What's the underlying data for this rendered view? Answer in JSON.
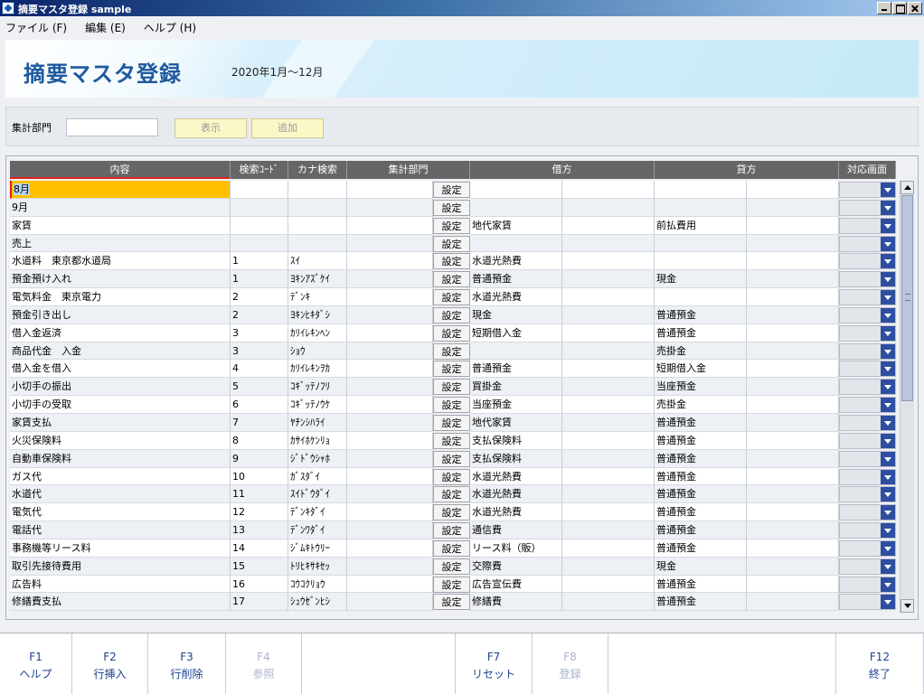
{
  "window": {
    "title": "摘要マスタ登録 sample"
  },
  "menu": [
    "ファイル (F)",
    "編集 (E)",
    "ヘルプ (H)"
  ],
  "banner": {
    "heading": "摘要マスタ登録",
    "period": "2020年1月～12月"
  },
  "filter": {
    "label": "集計部門",
    "value": "",
    "show_button": "表示",
    "add_button": "追加"
  },
  "columns": [
    "内容",
    "検索ｺｰﾄﾞ",
    "カナ検索",
    "集計部門",
    "借方",
    "貸方",
    "対応画面"
  ],
  "set_label": "設定",
  "rows": [
    {
      "naiyo": "8月",
      "code": "",
      "kana": "",
      "debit": "",
      "credit": ""
    },
    {
      "naiyo": "9月",
      "code": "",
      "kana": "",
      "debit": "",
      "credit": ""
    },
    {
      "naiyo": "家賃",
      "code": "",
      "kana": "",
      "debit": "地代家賃",
      "credit": "前払費用"
    },
    {
      "naiyo": "売上",
      "code": "",
      "kana": "",
      "debit": "",
      "credit": ""
    },
    {
      "naiyo": "水道料　東京都水道局",
      "code": "1",
      "kana": "ｽｲ",
      "debit": "水道光熱費",
      "credit": ""
    },
    {
      "naiyo": "預金預け入れ",
      "code": "1",
      "kana": "ﾖｷﾝｱｽﾞｹｲ",
      "debit": "普通預金",
      "credit": "現金"
    },
    {
      "naiyo": "電気料金　東京電力",
      "code": "2",
      "kana": "ﾃﾞﾝｷ",
      "debit": "水道光熱費",
      "credit": ""
    },
    {
      "naiyo": "預金引き出し",
      "code": "2",
      "kana": "ﾖｷﾝﾋｷﾀﾞｼ",
      "debit": "現金",
      "credit": "普通預金"
    },
    {
      "naiyo": "借入金返済",
      "code": "3",
      "kana": "ｶﾘｲﾚｷﾝﾍﾝ",
      "debit": "短期借入金",
      "credit": "普通預金"
    },
    {
      "naiyo": "商品代金　入金",
      "code": "3",
      "kana": "ｼｮｳ",
      "debit": "",
      "credit": "売掛金"
    },
    {
      "naiyo": "借入金を借入",
      "code": "4",
      "kana": "ｶﾘｲﾚｷﾝｦｶ",
      "debit": "普通預金",
      "credit": "短期借入金"
    },
    {
      "naiyo": "小切手の振出",
      "code": "5",
      "kana": "ｺｷﾞｯﾃﾉﾌﾘ",
      "debit": "買掛金",
      "credit": "当座預金"
    },
    {
      "naiyo": "小切手の受取",
      "code": "6",
      "kana": "ｺｷﾞｯﾃﾉｳｹ",
      "debit": "当座預金",
      "credit": "売掛金"
    },
    {
      "naiyo": "家賃支払",
      "code": "7",
      "kana": "ﾔﾁﾝｼﾊﾗｲ",
      "debit": "地代家賃",
      "credit": "普通預金"
    },
    {
      "naiyo": "火災保険料",
      "code": "8",
      "kana": "ｶｻｲﾎｹﾝﾘｮ",
      "debit": "支払保険料",
      "credit": "普通預金"
    },
    {
      "naiyo": "自動車保険料",
      "code": "9",
      "kana": "ｼﾞﾄﾞｳｼｬﾎ",
      "debit": "支払保険料",
      "credit": "普通預金"
    },
    {
      "naiyo": "ガス代",
      "code": "10",
      "kana": "ｶﾞｽﾀﾞｲ",
      "debit": "水道光熱費",
      "credit": "普通預金"
    },
    {
      "naiyo": "水道代",
      "code": "11",
      "kana": "ｽｲﾄﾞｳﾀﾞｲ",
      "debit": "水道光熱費",
      "credit": "普通預金"
    },
    {
      "naiyo": "電気代",
      "code": "12",
      "kana": "ﾃﾞﾝｷﾀﾞｲ",
      "debit": "水道光熱費",
      "credit": "普通預金"
    },
    {
      "naiyo": "電話代",
      "code": "13",
      "kana": "ﾃﾞﾝﾜﾀﾞｲ",
      "debit": "通信費",
      "credit": "普通預金"
    },
    {
      "naiyo": "事務機等リース料",
      "code": "14",
      "kana": "ｼﾞﾑｷﾄｳﾘｰ",
      "debit": "リース料（販）",
      "credit": "普通預金"
    },
    {
      "naiyo": "取引先接待費用",
      "code": "15",
      "kana": "ﾄﾘﾋｷｻｷｾｯ",
      "debit": "交際費",
      "credit": "現金"
    },
    {
      "naiyo": "広告料",
      "code": "16",
      "kana": "ｺｳｺｸﾘｮｳ",
      "debit": "広告宣伝費",
      "credit": "普通預金"
    },
    {
      "naiyo": "修繕費支払",
      "code": "17",
      "kana": "ｼｭｳｾﾞﾝﾋｼ",
      "debit": "修繕費",
      "credit": "普通預金"
    }
  ],
  "fkeys": [
    {
      "key": "F1",
      "label": "ヘルプ",
      "enabled": true
    },
    {
      "key": "F2",
      "label": "行挿入",
      "enabled": true
    },
    {
      "key": "F3",
      "label": "行削除",
      "enabled": true
    },
    {
      "key": "F4",
      "label": "参照",
      "enabled": false
    },
    {
      "key": "",
      "label": "",
      "enabled": false
    },
    {
      "key": "F7",
      "label": "リセット",
      "enabled": true
    },
    {
      "key": "F8",
      "label": "登録",
      "enabled": false
    },
    {
      "key": "",
      "label": "",
      "enabled": false
    },
    {
      "key": "F12",
      "label": "終了",
      "enabled": true
    }
  ]
}
